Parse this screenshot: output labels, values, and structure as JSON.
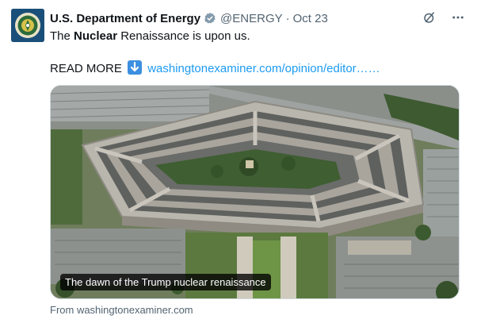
{
  "post": {
    "author_name": "U.S. Department of Energy",
    "handle": "@ENERGY",
    "separator": "·",
    "date": "Oct 23",
    "text_prefix": "The ",
    "text_bold": "Nuclear",
    "text_suffix": " Renaissance is upon us.",
    "read_more": "READ MORE",
    "link_text": "washingtonexaminer.com/opinion/editor……",
    "media_caption": "The dawn of the Trump nuclear renaissance",
    "source": "From washingtonexaminer.com",
    "icons": {
      "verified": "verified-badge-icon",
      "grok": "grok-icon",
      "more": "more-options-icon",
      "emoji": "down-arrow-emoji-icon"
    }
  },
  "colors": {
    "link": "#1d9bf0",
    "secondary_text": "#536471",
    "primary_text": "#0f1419",
    "verified_badge": "#829aab"
  }
}
